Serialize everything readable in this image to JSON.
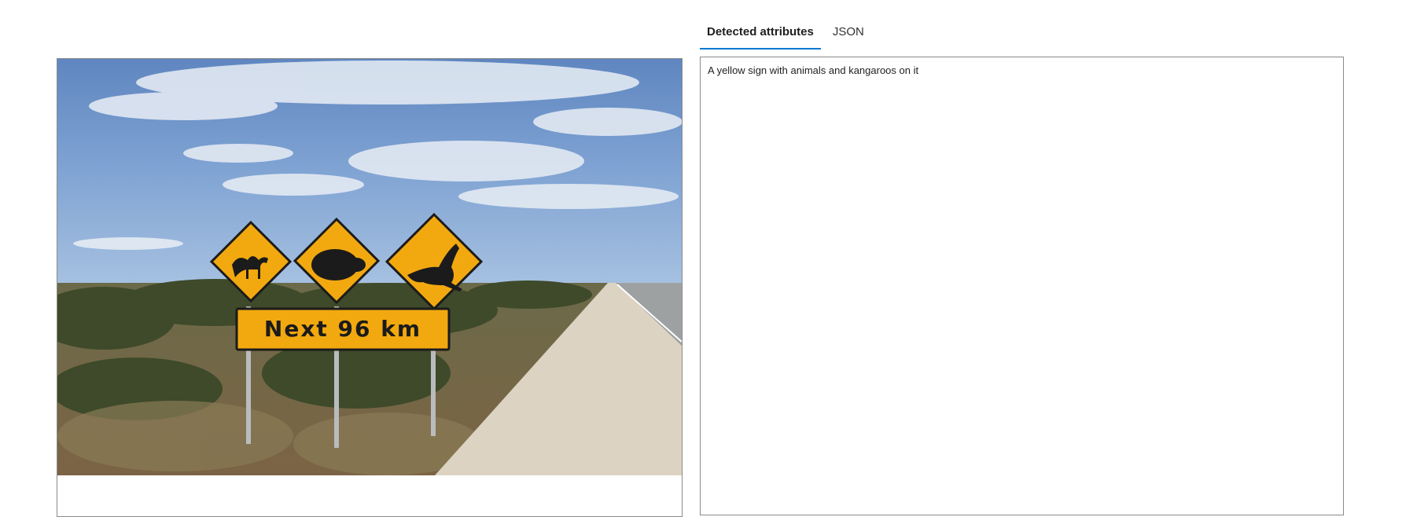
{
  "tabs": [
    {
      "label": "Detected attributes",
      "active": true
    },
    {
      "label": "JSON",
      "active": false
    }
  ],
  "result": {
    "caption": "A yellow sign with animals and kangaroos on it"
  },
  "image": {
    "sign_text": "Next 96 km",
    "sign_icons": [
      "camel-icon",
      "wombat-icon",
      "kangaroo-icon"
    ],
    "colors": {
      "sign_yellow": "#f2a90f",
      "tab_underline": "#0078d4"
    }
  }
}
